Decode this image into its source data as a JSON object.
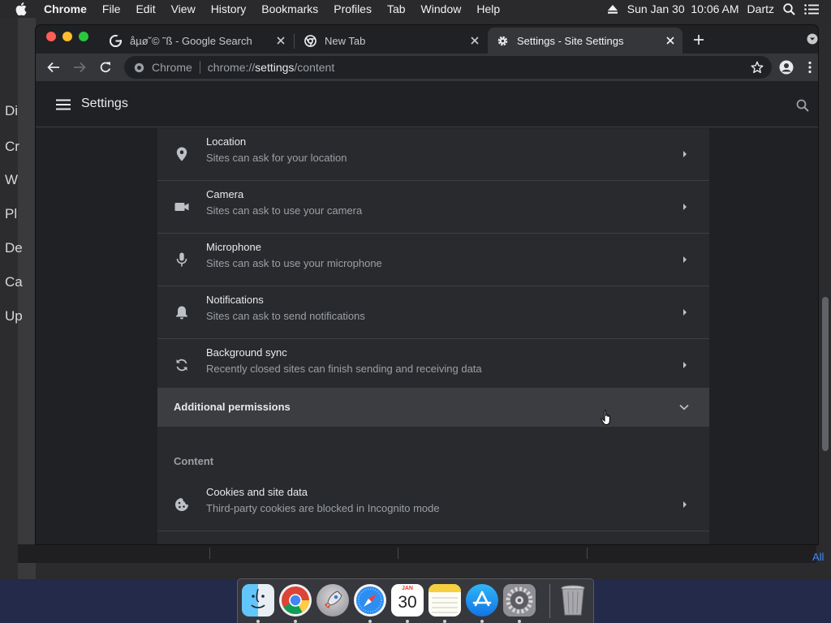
{
  "menubar": {
    "app": "Chrome",
    "items": [
      "File",
      "Edit",
      "View",
      "History",
      "Bookmarks",
      "Profiles",
      "Tab",
      "Window",
      "Help"
    ],
    "clock": "Sun Jan 30  10:06 AM",
    "user": "Dartz"
  },
  "background_window": {
    "letters": [
      "Di",
      "Cr",
      "W",
      "Pl",
      "De",
      "Ca",
      "Up"
    ],
    "link_text": "All"
  },
  "tabs": [
    {
      "title": "åµø˘© ˜ß - Google Search",
      "icon": "google-g-icon",
      "active": false
    },
    {
      "title": "New Tab",
      "icon": "chrome-logo-icon",
      "active": false
    },
    {
      "title": "Settings - Site Settings",
      "icon": "gear-icon",
      "active": true
    }
  ],
  "omnibox": {
    "origin_label": "Chrome",
    "url_scheme": "chrome://",
    "url_host": "settings",
    "url_path": "/content"
  },
  "settings": {
    "title": "Settings",
    "rows": [
      {
        "title": "Location",
        "subtitle": "Sites can ask for your location",
        "icon": "location-pin-icon"
      },
      {
        "title": "Camera",
        "subtitle": "Sites can ask to use your camera",
        "icon": "camera-icon"
      },
      {
        "title": "Microphone",
        "subtitle": "Sites can ask to use your microphone",
        "icon": "microphone-icon"
      },
      {
        "title": "Notifications",
        "subtitle": "Sites can ask to send notifications",
        "icon": "bell-icon"
      },
      {
        "title": "Background sync",
        "subtitle": "Recently closed sites can finish sending and receiving data",
        "icon": "sync-icon"
      }
    ],
    "additional_permissions": "Additional permissions",
    "content_heading": "Content",
    "cookies_row": {
      "title": "Cookies and site data",
      "subtitle": "Third-party cookies are blocked in Incognito mode",
      "icon": "cookie-icon"
    }
  },
  "dock": {
    "calendar_month": "JAN",
    "calendar_day": "30",
    "apps": [
      "finder-icon",
      "chrome-icon",
      "launchpad-icon",
      "safari-icon",
      "calendar-icon",
      "notes-icon",
      "app-store-icon",
      "system-preferences-icon",
      "trash-icon"
    ]
  },
  "colors": {
    "page_bg": "#202124",
    "card_bg": "#292a2d",
    "accent_blue": "#3d8bff"
  }
}
